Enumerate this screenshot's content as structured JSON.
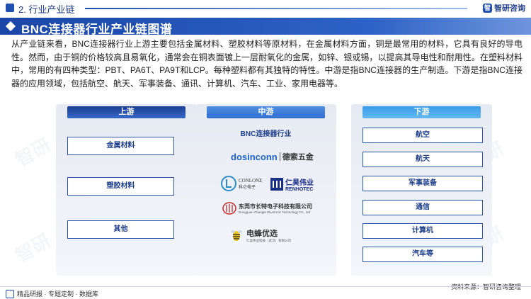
{
  "header": {
    "section_title": "2. 行业产业链",
    "brand_name": "智研咨询",
    "brand_logo_char": "智"
  },
  "title": "BNC连接器行业产业链图谱",
  "intro": "从产业链来看，BNC连接器行业上游主要包括金属材料、塑胶材料等原材料，在金属材料方面，铜是最常用的材料，它具有良好的导电性。然而，由于铜的价格较高且易氧化，通常会在铜表面镀上一层耐氧化的金属，如锌、银或锡，以提高其导电性和耐用性。在塑料材料中，常用的有四种类型：PBT、PA6T、PA9T和LCP。每种塑料都有其独特的特性。中游是指BNC连接器的生产制造。下游是指BNC连接器的应用领域，包括航空、航天、军事装备、通讯、计算机、汽车、工业、家用电器等。",
  "upstream": {
    "header": "上游",
    "items": [
      "金属材料",
      "塑胶材料",
      "其他"
    ]
  },
  "midstream": {
    "header": "中游",
    "label": "BNC连接器行业",
    "companies": {
      "dosinconn_en": "dosinconn",
      "dosinconn_cn": "德索五金",
      "conlone_en": "CONLONE",
      "conlone_cn": "科仑电子",
      "renhotec_cn": "仁昊伟业",
      "renhotec_en": "RENHOTEC",
      "changte_cn": "东莞市长特电子科技有限公司",
      "changte_en": "Dongguan Changte Electronic Technology Co., Ltd",
      "dianfeng_cn": "电蜂优选",
      "dianfeng_sub": "仁昊伟业科技（武汉）有限公司"
    }
  },
  "downstream": {
    "header": "下游",
    "items": [
      "航空",
      "航天",
      "军事装备",
      "通信",
      "计算机",
      "汽车等"
    ]
  },
  "footer": {
    "left_text": "精品研报 · 专题定制 · 数据库",
    "source": "资料来源：智研咨询整理"
  },
  "colors": {
    "primary": "#1f4fb0",
    "title_bar": "#2d63c6",
    "box_border": "#2c55a8",
    "text_blue": "#1c3e8a"
  },
  "watermark_text": "智研"
}
